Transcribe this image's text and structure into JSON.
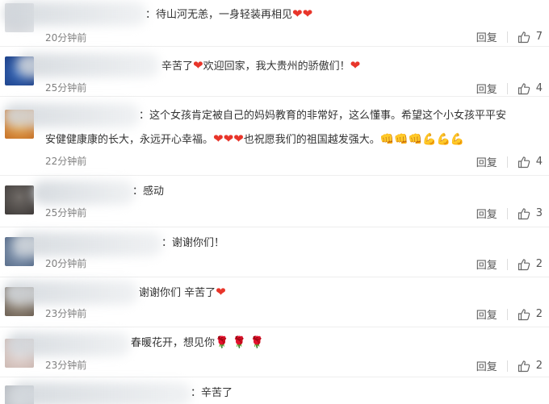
{
  "ui": {
    "reply_label": "回复"
  },
  "comments": [
    {
      "text": "：待山河无恙，一身轻装再相见",
      "suffix": "❤❤",
      "time": "20分钟前",
      "likes": "7"
    },
    {
      "text": "辛苦了",
      "mid": "❤",
      "text2": "欢迎回家，我大贵州的骄傲们！",
      "suffix": "❤",
      "time": "25分钟前",
      "likes": "4"
    },
    {
      "line1": "：这个女孩肯定被自己的妈妈教育的非常好，这么懂事。希望这个小女孩平平安",
      "line2": "安健健康康的长大，永远开心幸福。",
      "hearts": "❤❤❤",
      "line2b": "也祝愿我们的祖国越发强大。",
      "suffix": "👊👊👊💪💪💪",
      "time": "22分钟前",
      "likes": "4"
    },
    {
      "text": "：感动",
      "time": "25分钟前",
      "likes": "3"
    },
    {
      "text": "：谢谢你们！",
      "time": "20分钟前",
      "likes": "2"
    },
    {
      "text": "谢谢你们 辛苦了",
      "suffix": "❤",
      "time": "23分钟前",
      "likes": "2"
    },
    {
      "text": "春暖花开，想见你",
      "suffix": "🌹 🌹 🌹",
      "time": "23分钟前",
      "likes": "2"
    },
    {
      "text": "：辛苦了"
    }
  ]
}
